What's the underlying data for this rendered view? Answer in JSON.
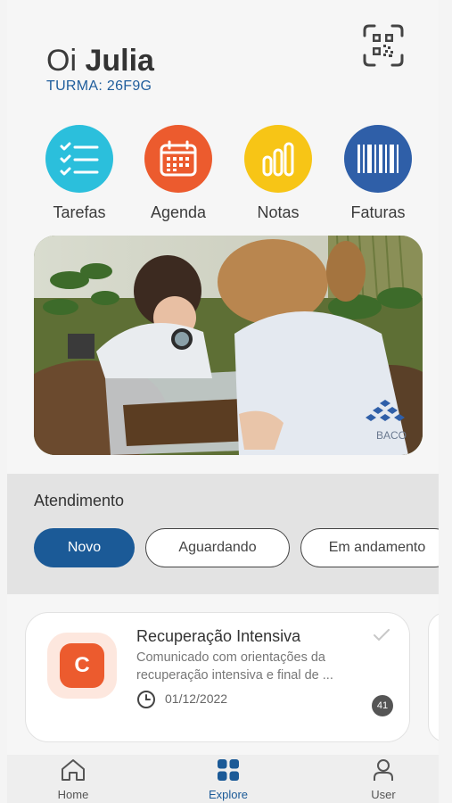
{
  "header": {
    "greeting": "Oi",
    "name": "Julia",
    "turma": "TURMA: 26F9G",
    "qr_icon": "qr-code-icon"
  },
  "shortcuts": [
    {
      "label": "Tarefas",
      "icon": "checklist-icon",
      "color": "#2bbfdc"
    },
    {
      "label": "Agenda",
      "icon": "calendar-icon",
      "color": "#ec5b2e"
    },
    {
      "label": "Notas",
      "icon": "bar-chart-icon",
      "color": "#f7c516"
    },
    {
      "label": "Faturas",
      "icon": "barcode-icon",
      "color": "#2f5fa8"
    }
  ],
  "banner": {
    "logo_text": "BACO"
  },
  "atendimento": {
    "title": "Atendimento",
    "filters": [
      {
        "label": "Novo",
        "active": true
      },
      {
        "label": "Aguardando",
        "active": false
      },
      {
        "label": "Em andamento",
        "active": false
      }
    ]
  },
  "card": {
    "icon_letter": "C",
    "title": "Recuperação Intensiva",
    "description": "Comunicado com orientações da recuperação intensiva e final de ...",
    "date": "01/12/2022",
    "count": "41"
  },
  "nav": [
    {
      "label": "Home",
      "icon": "home-icon",
      "active": false
    },
    {
      "label": "Explore",
      "icon": "grid-icon",
      "active": true
    },
    {
      "label": "User",
      "icon": "user-icon",
      "active": false
    }
  ],
  "colors": {
    "brand_blue": "#1b5a97",
    "accent_orange": "#ec5b2e"
  }
}
